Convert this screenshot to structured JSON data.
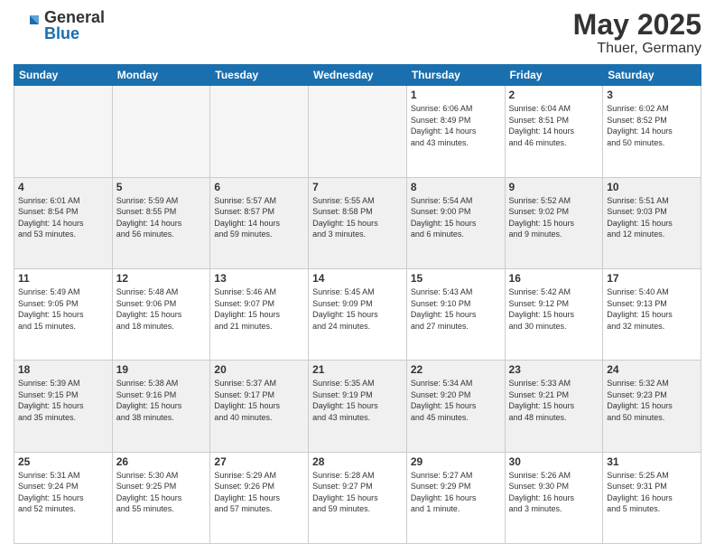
{
  "header": {
    "logo_general": "General",
    "logo_blue": "Blue",
    "month": "May 2025",
    "location": "Thuer, Germany"
  },
  "weekdays": [
    "Sunday",
    "Monday",
    "Tuesday",
    "Wednesday",
    "Thursday",
    "Friday",
    "Saturday"
  ],
  "weeks": [
    [
      {
        "day": "",
        "info": ""
      },
      {
        "day": "",
        "info": ""
      },
      {
        "day": "",
        "info": ""
      },
      {
        "day": "",
        "info": ""
      },
      {
        "day": "1",
        "info": "Sunrise: 6:06 AM\nSunset: 8:49 PM\nDaylight: 14 hours\nand 43 minutes."
      },
      {
        "day": "2",
        "info": "Sunrise: 6:04 AM\nSunset: 8:51 PM\nDaylight: 14 hours\nand 46 minutes."
      },
      {
        "day": "3",
        "info": "Sunrise: 6:02 AM\nSunset: 8:52 PM\nDaylight: 14 hours\nand 50 minutes."
      }
    ],
    [
      {
        "day": "4",
        "info": "Sunrise: 6:01 AM\nSunset: 8:54 PM\nDaylight: 14 hours\nand 53 minutes."
      },
      {
        "day": "5",
        "info": "Sunrise: 5:59 AM\nSunset: 8:55 PM\nDaylight: 14 hours\nand 56 minutes."
      },
      {
        "day": "6",
        "info": "Sunrise: 5:57 AM\nSunset: 8:57 PM\nDaylight: 14 hours\nand 59 minutes."
      },
      {
        "day": "7",
        "info": "Sunrise: 5:55 AM\nSunset: 8:58 PM\nDaylight: 15 hours\nand 3 minutes."
      },
      {
        "day": "8",
        "info": "Sunrise: 5:54 AM\nSunset: 9:00 PM\nDaylight: 15 hours\nand 6 minutes."
      },
      {
        "day": "9",
        "info": "Sunrise: 5:52 AM\nSunset: 9:02 PM\nDaylight: 15 hours\nand 9 minutes."
      },
      {
        "day": "10",
        "info": "Sunrise: 5:51 AM\nSunset: 9:03 PM\nDaylight: 15 hours\nand 12 minutes."
      }
    ],
    [
      {
        "day": "11",
        "info": "Sunrise: 5:49 AM\nSunset: 9:05 PM\nDaylight: 15 hours\nand 15 minutes."
      },
      {
        "day": "12",
        "info": "Sunrise: 5:48 AM\nSunset: 9:06 PM\nDaylight: 15 hours\nand 18 minutes."
      },
      {
        "day": "13",
        "info": "Sunrise: 5:46 AM\nSunset: 9:07 PM\nDaylight: 15 hours\nand 21 minutes."
      },
      {
        "day": "14",
        "info": "Sunrise: 5:45 AM\nSunset: 9:09 PM\nDaylight: 15 hours\nand 24 minutes."
      },
      {
        "day": "15",
        "info": "Sunrise: 5:43 AM\nSunset: 9:10 PM\nDaylight: 15 hours\nand 27 minutes."
      },
      {
        "day": "16",
        "info": "Sunrise: 5:42 AM\nSunset: 9:12 PM\nDaylight: 15 hours\nand 30 minutes."
      },
      {
        "day": "17",
        "info": "Sunrise: 5:40 AM\nSunset: 9:13 PM\nDaylight: 15 hours\nand 32 minutes."
      }
    ],
    [
      {
        "day": "18",
        "info": "Sunrise: 5:39 AM\nSunset: 9:15 PM\nDaylight: 15 hours\nand 35 minutes."
      },
      {
        "day": "19",
        "info": "Sunrise: 5:38 AM\nSunset: 9:16 PM\nDaylight: 15 hours\nand 38 minutes."
      },
      {
        "day": "20",
        "info": "Sunrise: 5:37 AM\nSunset: 9:17 PM\nDaylight: 15 hours\nand 40 minutes."
      },
      {
        "day": "21",
        "info": "Sunrise: 5:35 AM\nSunset: 9:19 PM\nDaylight: 15 hours\nand 43 minutes."
      },
      {
        "day": "22",
        "info": "Sunrise: 5:34 AM\nSunset: 9:20 PM\nDaylight: 15 hours\nand 45 minutes."
      },
      {
        "day": "23",
        "info": "Sunrise: 5:33 AM\nSunset: 9:21 PM\nDaylight: 15 hours\nand 48 minutes."
      },
      {
        "day": "24",
        "info": "Sunrise: 5:32 AM\nSunset: 9:23 PM\nDaylight: 15 hours\nand 50 minutes."
      }
    ],
    [
      {
        "day": "25",
        "info": "Sunrise: 5:31 AM\nSunset: 9:24 PM\nDaylight: 15 hours\nand 52 minutes."
      },
      {
        "day": "26",
        "info": "Sunrise: 5:30 AM\nSunset: 9:25 PM\nDaylight: 15 hours\nand 55 minutes."
      },
      {
        "day": "27",
        "info": "Sunrise: 5:29 AM\nSunset: 9:26 PM\nDaylight: 15 hours\nand 57 minutes."
      },
      {
        "day": "28",
        "info": "Sunrise: 5:28 AM\nSunset: 9:27 PM\nDaylight: 15 hours\nand 59 minutes."
      },
      {
        "day": "29",
        "info": "Sunrise: 5:27 AM\nSunset: 9:29 PM\nDaylight: 16 hours\nand 1 minute."
      },
      {
        "day": "30",
        "info": "Sunrise: 5:26 AM\nSunset: 9:30 PM\nDaylight: 16 hours\nand 3 minutes."
      },
      {
        "day": "31",
        "info": "Sunrise: 5:25 AM\nSunset: 9:31 PM\nDaylight: 16 hours\nand 5 minutes."
      }
    ]
  ]
}
